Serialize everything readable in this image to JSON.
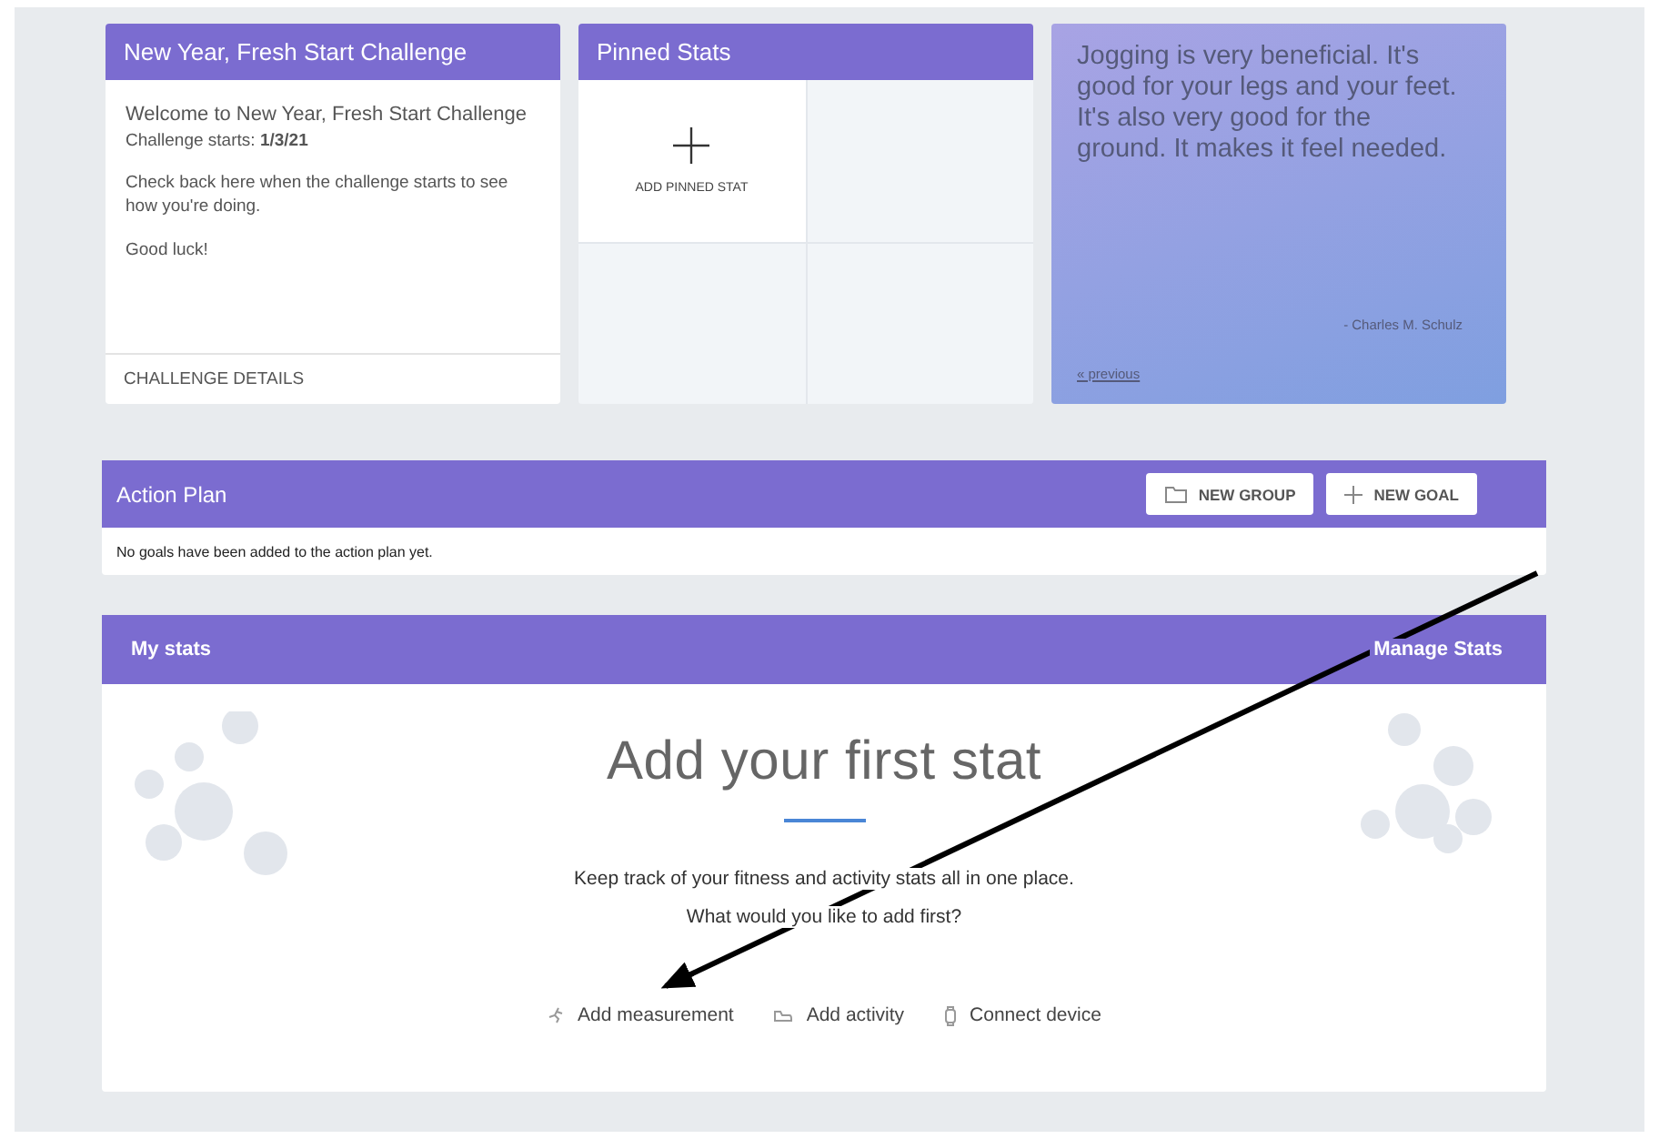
{
  "challenge_card": {
    "title": "New Year, Fresh Start Challenge",
    "welcome": "Welcome to New Year, Fresh Start Challenge",
    "starts": "Challenge starts: **1/3/21**",
    "check_back": "Check back here when the challenge starts to see how you're doing.",
    "good_luck": "Good luck!",
    "footer_link": "CHALLENGE DETAILS"
  },
  "pinned_stats": {
    "title": "Pinned Stats",
    "add_label": "ADD PINNED STAT"
  },
  "quote": {
    "text": "Jogging is very beneficial. It's good for your legs and your feet. It's also very good for the ground. It makes it feel needed.",
    "author": "- Charles M. Schulz",
    "previous_link": "« previous"
  },
  "action_plan": {
    "title": "Action Plan",
    "buttons": [
      {
        "label": "NEW GROUP",
        "kind": "group"
      },
      {
        "label": "NEW GOAL",
        "kind": "goal"
      }
    ],
    "empty_message": "No goals have been added to the action plan yet."
  },
  "my_stats": {
    "title": "My stats",
    "manage_link": "Manage Stats",
    "heading": "Add your first stat",
    "description": "Keep track of your fitness and activity stats all in one place.",
    "question": "What would you like to add first?",
    "actions": [
      {
        "label": "Add measurement",
        "kind": "measurement"
      },
      {
        "label": "Add activity",
        "kind": "activity"
      },
      {
        "label": "Connect device",
        "kind": "device"
      }
    ]
  }
}
